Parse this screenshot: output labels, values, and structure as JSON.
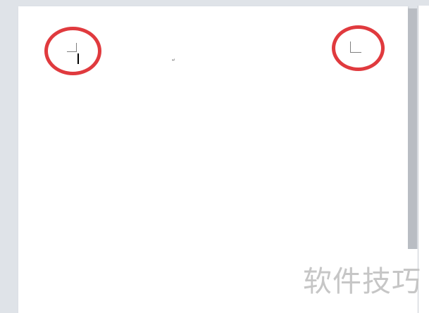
{
  "document": {
    "paragraph_mark": "↵"
  },
  "watermark": {
    "text": "软件技巧"
  },
  "colors": {
    "annotation_circle": "#e03a3e",
    "crop_mark": "#7f7f7f",
    "workspace_background": "#dfe3e8",
    "page_background": "#ffffff",
    "watermark_text": "#c6c6c6"
  }
}
